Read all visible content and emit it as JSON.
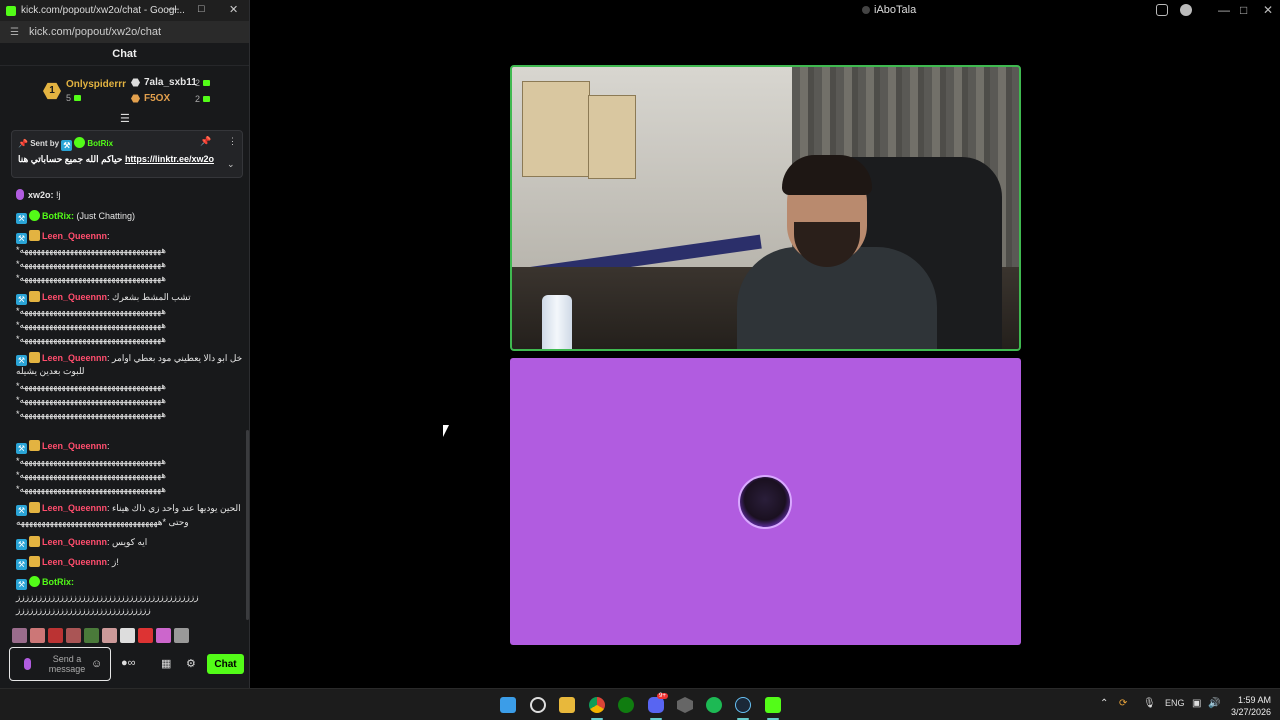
{
  "background_window": {
    "title": "iAboTala"
  },
  "popup": {
    "title": "kick.com/popout/xw2o/chat - Googl...",
    "url": "kick.com/popout/xw2o/chat",
    "chat_header": "Chat",
    "leaderboard": [
      {
        "rank": "1",
        "name": "Onlyspiderrr",
        "count": "5",
        "color": "#e3b341"
      },
      {
        "name": "7ala_sxb11",
        "count": "2",
        "color": "#e6e6e6"
      },
      {
        "name": "F5OX",
        "count": "2",
        "color": "#e3a04d"
      }
    ],
    "pinned": {
      "sent_by": "Sent by",
      "bot_name": "BotRix",
      "message": "حياكم الله جميع حساباتي هنا",
      "link": "https://linktr.ee/xw2o"
    },
    "messages": [
      {
        "user": "xw2o",
        "text": "!j"
      },
      {
        "user": "BotRix",
        "text": "(Just Chatting)"
      },
      {
        "user": "Leen_Queennn",
        "text": ""
      },
      {
        "user": "",
        "text": "*ههههههههههههههههههههههههههههههههههه"
      },
      {
        "user": "",
        "text": "*ههههههههههههههههههههههههههههههههههه"
      },
      {
        "user": "",
        "text": "*ههههههههههههههههههههههههههههههههههه"
      },
      {
        "user": "Leen_Queennn",
        "text": "تشب المشط بشعرك"
      },
      {
        "user": "",
        "text": "*ههههههههههههههههههههههههههههههههههه"
      },
      {
        "user": "",
        "text": "*ههههههههههههههههههههههههههههههههههه"
      },
      {
        "user": "",
        "text": "*ههههههههههههههههههههههههههههههههههه"
      },
      {
        "user": "Leen_Queennn",
        "text": "خل ابو دالا يعطيني مود بعطي اوامر"
      },
      {
        "user": "",
        "text": "للبوت بعدين يشيله"
      },
      {
        "user": "",
        "text": "*ههههههههههههههههههههههههههههههههههه"
      },
      {
        "user": "",
        "text": "*ههههههههههههههههههههههههههههههههههه"
      },
      {
        "user": "",
        "text": "*ههههههههههههههههههههههههههههههههههه"
      },
      {
        "user": "Leen_Queennn",
        "text": ""
      },
      {
        "user": "",
        "text": "*ههههههههههههههههههههههههههههههههههه"
      },
      {
        "user": "",
        "text": "*ههههههههههههههههههههههههههههههههههه"
      },
      {
        "user": "",
        "text": "*ههههههههههههههههههههههههههههههههههه"
      },
      {
        "user": "Leen_Queennn",
        "text": "الحين يوديها عند واحد زي ذاك هيناء"
      },
      {
        "user": "",
        "text": "وحتى *ههههههههههههههههههههههههههههههههههه"
      },
      {
        "user": "Leen_Queennn",
        "text": "ايه كويس"
      },
      {
        "user": "Leen_Queennn",
        "text": "ز!"
      },
      {
        "user": "BotRix",
        "text": ""
      },
      {
        "user": "",
        "text": "زززززززززززززززززززززززززززززززززززززززززز"
      },
      {
        "user": "",
        "text": "ززززززززززززززززززززززززززززززز"
      }
    ],
    "input_placeholder": "Send a message",
    "chat_button": "Chat"
  },
  "taskbar": {
    "lang": "ENG",
    "time": "1:59 AM",
    "date": "3/27/2026",
    "discord_badge": "9+"
  },
  "colors": {
    "kick_green": "#53fc18",
    "avatar_tile": "#b15ce0",
    "cam_border": "#3fb950",
    "leen_name": "#ff4d6d"
  }
}
